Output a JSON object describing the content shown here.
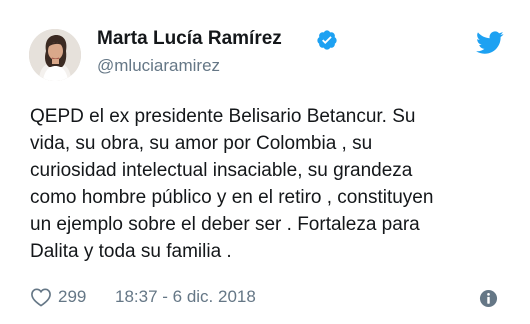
{
  "tweet": {
    "author": {
      "display_name": "Marta Lucía Ramírez",
      "handle": "@mluciaramirez",
      "verified": true,
      "avatar_icon": "profile-photo"
    },
    "text_lines": [
      "QEPD el ex presidente Belisario Betancur. Su",
      "vida, su obra, su amor por Colombia , su",
      "curiosidad intelectual insaciable, su grandeza",
      "como hombre público y en el retiro , constituyen",
      "un ejemplo sobre el deber ser . Fortaleza para",
      "Dalita y toda su familia ."
    ],
    "likes": "299",
    "timestamp": "18:37 - 6 dic. 2018"
  },
  "icons": {
    "verified": "verified-badge-icon",
    "brand": "twitter-bird-icon",
    "like": "heart-icon",
    "info": "info-icon"
  },
  "colors": {
    "text": "#14171a",
    "secondary": "#657786",
    "twitter_blue": "#1da1f2",
    "background": "#ffffff"
  }
}
